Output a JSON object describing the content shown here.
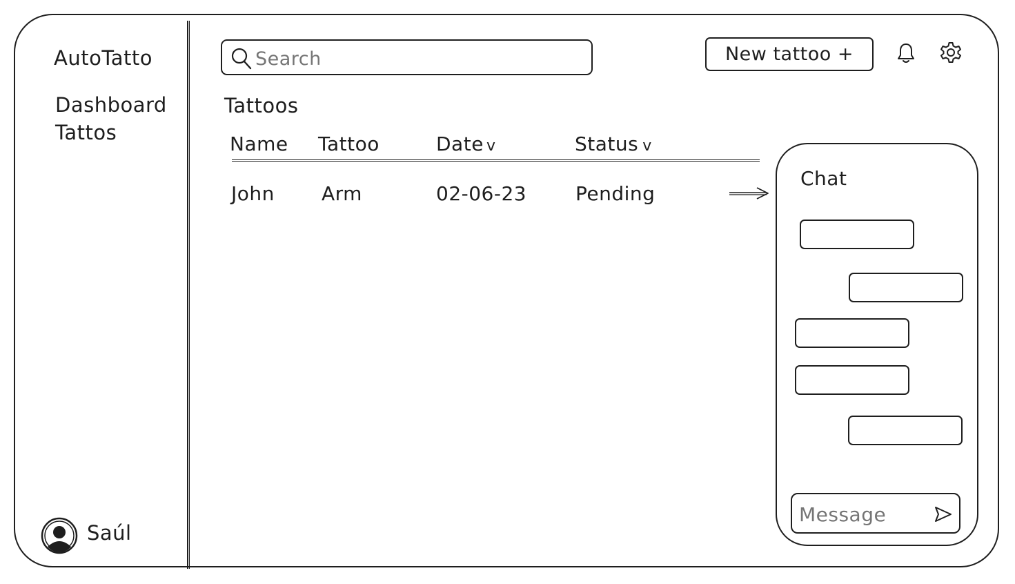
{
  "app": {
    "brand": "AutoTatto"
  },
  "sidebar": {
    "items": [
      {
        "label": "Dashboard"
      },
      {
        "label": "Tattos"
      }
    ],
    "user": {
      "name": "Saúl",
      "icon": "avatar-icon"
    }
  },
  "header": {
    "search": {
      "placeholder": "Search",
      "icon": "search-icon"
    },
    "new_button_label": "New tattoo +",
    "icons": [
      "bell-icon",
      "gear-icon"
    ]
  },
  "main": {
    "title": "Tattoos",
    "table": {
      "columns": [
        {
          "label": "Name",
          "sortable": false
        },
        {
          "label": "Tattoo",
          "sortable": false
        },
        {
          "label": "Date",
          "sortable": true,
          "indicator": "v"
        },
        {
          "label": "Status",
          "sortable": true,
          "indicator": "v"
        }
      ],
      "rows": [
        {
          "name": "John",
          "tattoo": "Arm",
          "date": "02-06-23",
          "status": "Pending"
        }
      ]
    }
  },
  "chat": {
    "title": "Chat",
    "bubbles": [
      {
        "side": "left",
        "text": ""
      },
      {
        "side": "right",
        "text": ""
      },
      {
        "side": "left",
        "text": ""
      },
      {
        "side": "left",
        "text": ""
      },
      {
        "side": "right",
        "text": ""
      }
    ],
    "input_placeholder": "Message",
    "send_icon": "send-icon"
  }
}
